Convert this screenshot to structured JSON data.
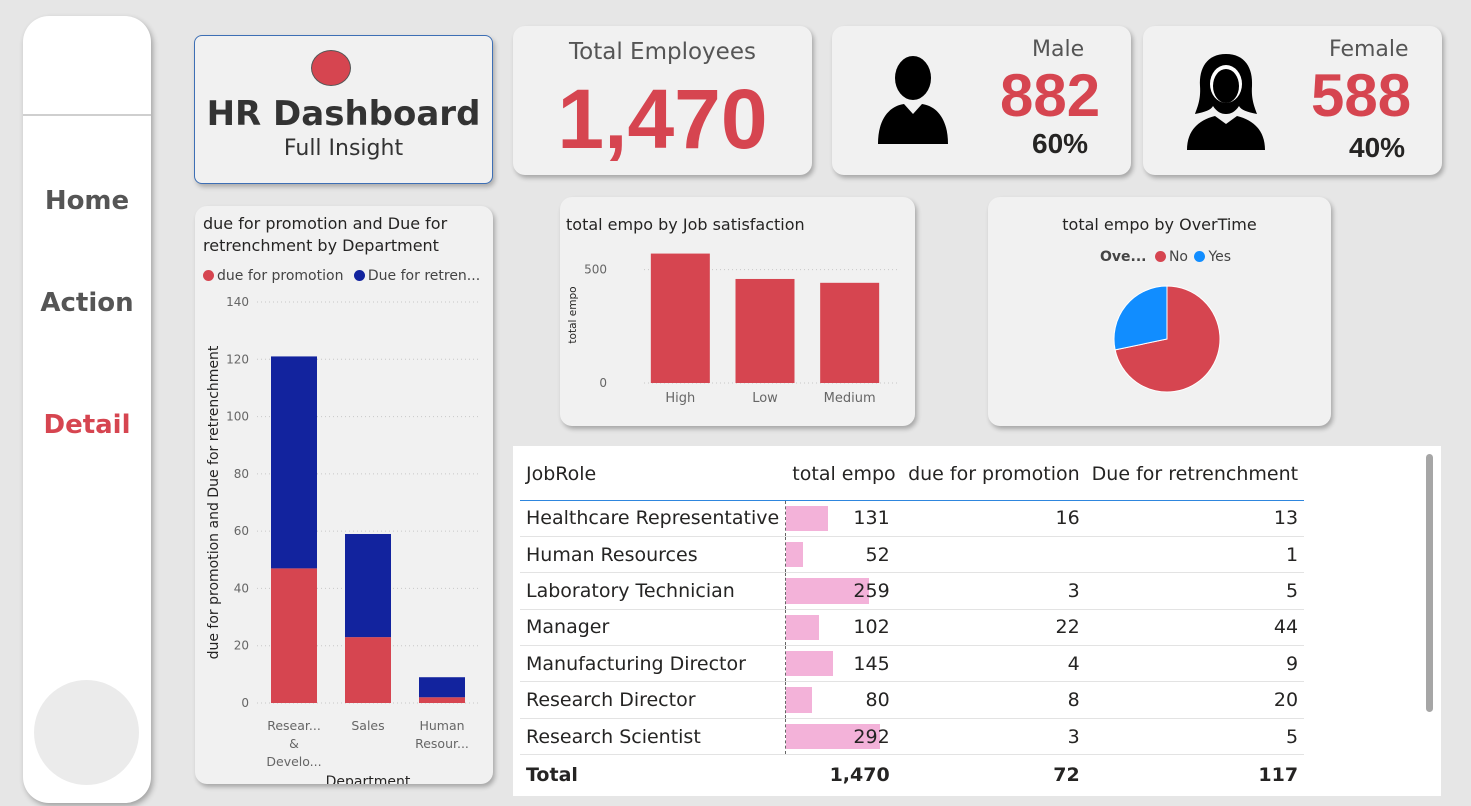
{
  "nav": {
    "home": "Home",
    "action": "Action",
    "detail": "Detail"
  },
  "header": {
    "title": "HR Dashboard",
    "subtitle": "Full Insight"
  },
  "kpis": {
    "total": {
      "label": "Total Employees",
      "value": "1,470"
    },
    "male": {
      "label": "Male",
      "value": "882",
      "pct": "60%",
      "icon": "male-user-icon"
    },
    "female": {
      "label": "Female",
      "value": "588",
      "pct": "40%",
      "icon": "female-user-icon"
    }
  },
  "colors": {
    "accent": "#d64550",
    "navy": "#12239e",
    "blue": "#118dff",
    "pink_bar": "#f3b2d9"
  },
  "chart_data": [
    {
      "type": "bar",
      "stacked": true,
      "title": "due for promotion and Due for retrenchment by Department",
      "xlabel": "Department",
      "ylabel": "due for promotion and Due for retrenchment",
      "legend_position": "top-left",
      "ylim": [
        0,
        140
      ],
      "yticks": [
        "140",
        "120",
        "100",
        "80",
        "60",
        "40",
        "20",
        "0"
      ],
      "categories": [
        "Resear... & Develo...",
        "Sales",
        "Human Resour..."
      ],
      "category_lines": [
        [
          "Resear...",
          "&",
          "Develo..."
        ],
        [
          "Sales"
        ],
        [
          "Human",
          "Resour..."
        ]
      ],
      "series": [
        {
          "name": "due for promotion",
          "legend": "due for promotion",
          "color": "#d64550",
          "values": [
            47,
            23,
            2
          ]
        },
        {
          "name": "Due for retrenchment",
          "legend": "Due for retren...",
          "color": "#12239e",
          "values": [
            74,
            36,
            7
          ]
        }
      ],
      "grid": true
    },
    {
      "type": "bar",
      "title": "total empo by Job satisfaction",
      "ylabel": "total empo",
      "xlabel": "",
      "ylim": [
        0,
        600
      ],
      "yticks": [
        "500",
        "0"
      ],
      "categories": [
        "High",
        "Low",
        "Medium"
      ],
      "values": [
        571,
        459,
        442
      ],
      "color": "#d64550",
      "grid": true
    },
    {
      "type": "pie",
      "title": "total empo by OverTime",
      "legend_title": "Ove...",
      "legend_position": "top-center",
      "slices": [
        {
          "label": "No",
          "value": 1054,
          "color": "#d64550"
        },
        {
          "label": "Yes",
          "value": 416,
          "color": "#118dff"
        }
      ]
    },
    {
      "type": "table",
      "columns": [
        "JobRole",
        "total empo",
        "due for promotion",
        "Due for retrenchment"
      ],
      "rows": [
        [
          "Healthcare Representative",
          "131",
          "16",
          "13"
        ],
        [
          "Human Resources",
          "52",
          "",
          "1"
        ],
        [
          "Laboratory Technician",
          "259",
          "3",
          "5"
        ],
        [
          "Manager",
          "102",
          "22",
          "44"
        ],
        [
          "Manufacturing Director",
          "145",
          "4",
          "9"
        ],
        [
          "Research Director",
          "80",
          "8",
          "20"
        ],
        [
          "Research Scientist",
          "292",
          "3",
          "5"
        ]
      ],
      "total": [
        "Total",
        "1,470",
        "72",
        "117"
      ]
    }
  ]
}
